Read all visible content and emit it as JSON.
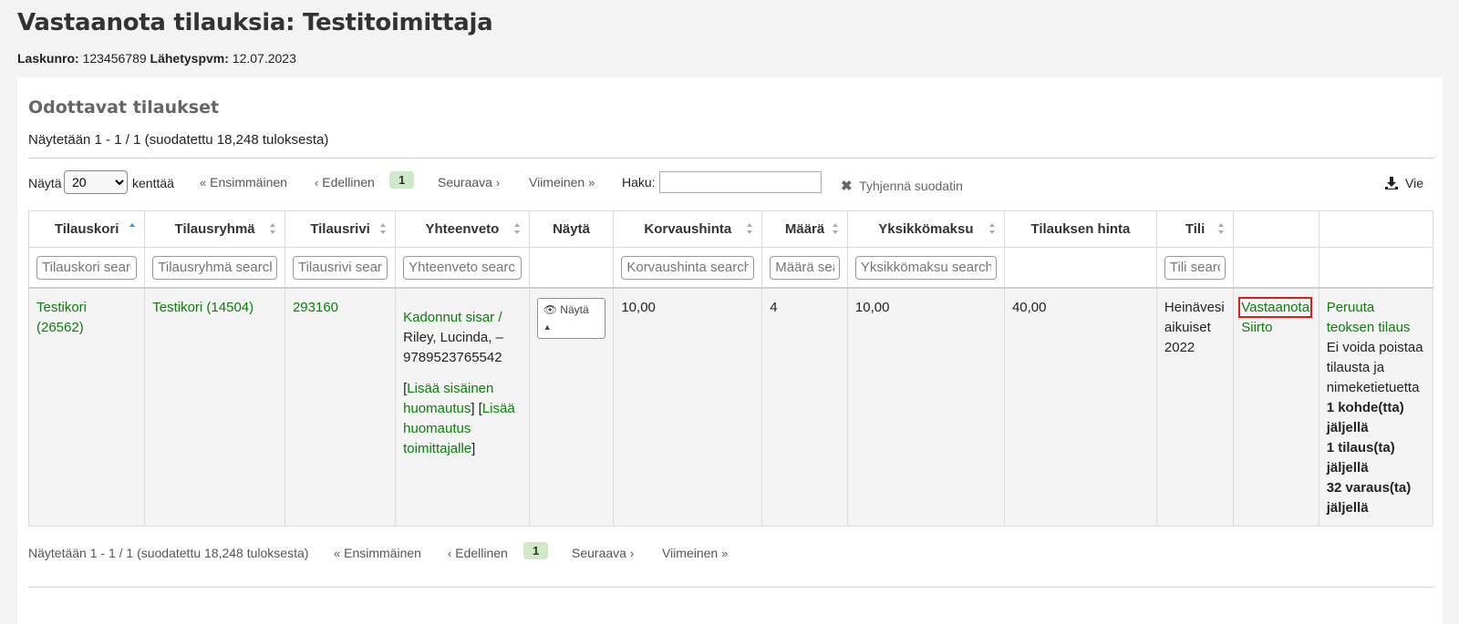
{
  "header": {
    "title": "Vastaanota tilauksia: Testitoimittaja",
    "invoice_label": "Laskunro:",
    "invoice_value": "123456789",
    "date_label": "Lähetyspvm:",
    "date_value": "12.07.2023"
  },
  "section": {
    "title": "Odottavat tilaukset",
    "info": "Näytetään 1 - 1 / 1 (suodatettu 18,248 tuloksesta)"
  },
  "toolbar": {
    "show_label": "Näytä",
    "page_size": "20",
    "entries_label": "kenttää",
    "first": "Ensimmäinen",
    "prev": "Edellinen",
    "current_page": "1",
    "next": "Seuraava",
    "last": "Viimeinen",
    "search_label": "Haku:",
    "search_value": "",
    "clear_filter": "Tyhjennä suodatin",
    "export": "Vie"
  },
  "table": {
    "headers": {
      "basket": "Tilauskori",
      "group": "Tilausryhmä",
      "line": "Tilausrivi",
      "summary": "Yhteenveto",
      "view": "Näytä",
      "replacement": "Korvaushinta",
      "quantity": "Määrä",
      "unitcost": "Yksikkömaksu",
      "ordercost": "Tilauksen hinta",
      "fund": "Tili",
      "actions1": "",
      "actions2": ""
    },
    "filters": {
      "basket": "Tilauskori search",
      "group": "Tilausryhmä search",
      "line": "Tilausrivi search",
      "summary": "Yhteenveto search",
      "replacement": "Korvaushinta search",
      "quantity": "Määrä search",
      "unitcost": "Yksikkömaksu search",
      "fund": "Tili search"
    },
    "row": {
      "basket": "Testikori (26562)",
      "group": "Testikori (14504)",
      "line": "293160",
      "title": "Kadonnut sisar /",
      "author": "Riley, Lucinda, –",
      "isbn": "9789523765542",
      "note_open": "[",
      "internal_note": "Lisää sisäinen huomautus",
      "note_mid": "] [",
      "vendor_note": "Lisää huomautus toimittajalle",
      "note_close": "]",
      "view_button": "Näytä",
      "replacement": "10,00",
      "quantity": "4",
      "unitcost": "10,00",
      "ordercost": "40,00",
      "fund": "Heinävesi aikuiset 2022",
      "receive": "Vastaanota",
      "transfer": "Siirto",
      "cancel": "Peruuta teoksen tilaus",
      "cannot_delete": "Ei voida poistaa tilausta ja nimeketietuetta",
      "items_left": "1 kohde(tta) jäljellä",
      "orders_left": "1 tilaus(ta) jäljellä",
      "holds_left": "32 varaus(ta) jäljellä"
    }
  },
  "bottom_pager": {
    "info": "Näytetään 1 - 1 / 1 (suodatettu 18,248 tuloksesta)",
    "first": "Ensimmäinen",
    "prev": "Edellinen",
    "current_page": "1",
    "next": "Seuraava",
    "last": "Viimeinen"
  },
  "colors": {
    "link": "#0b7d0b",
    "highlight_border": "#d81f1f",
    "current_page_bg": "#cfe8c7"
  }
}
